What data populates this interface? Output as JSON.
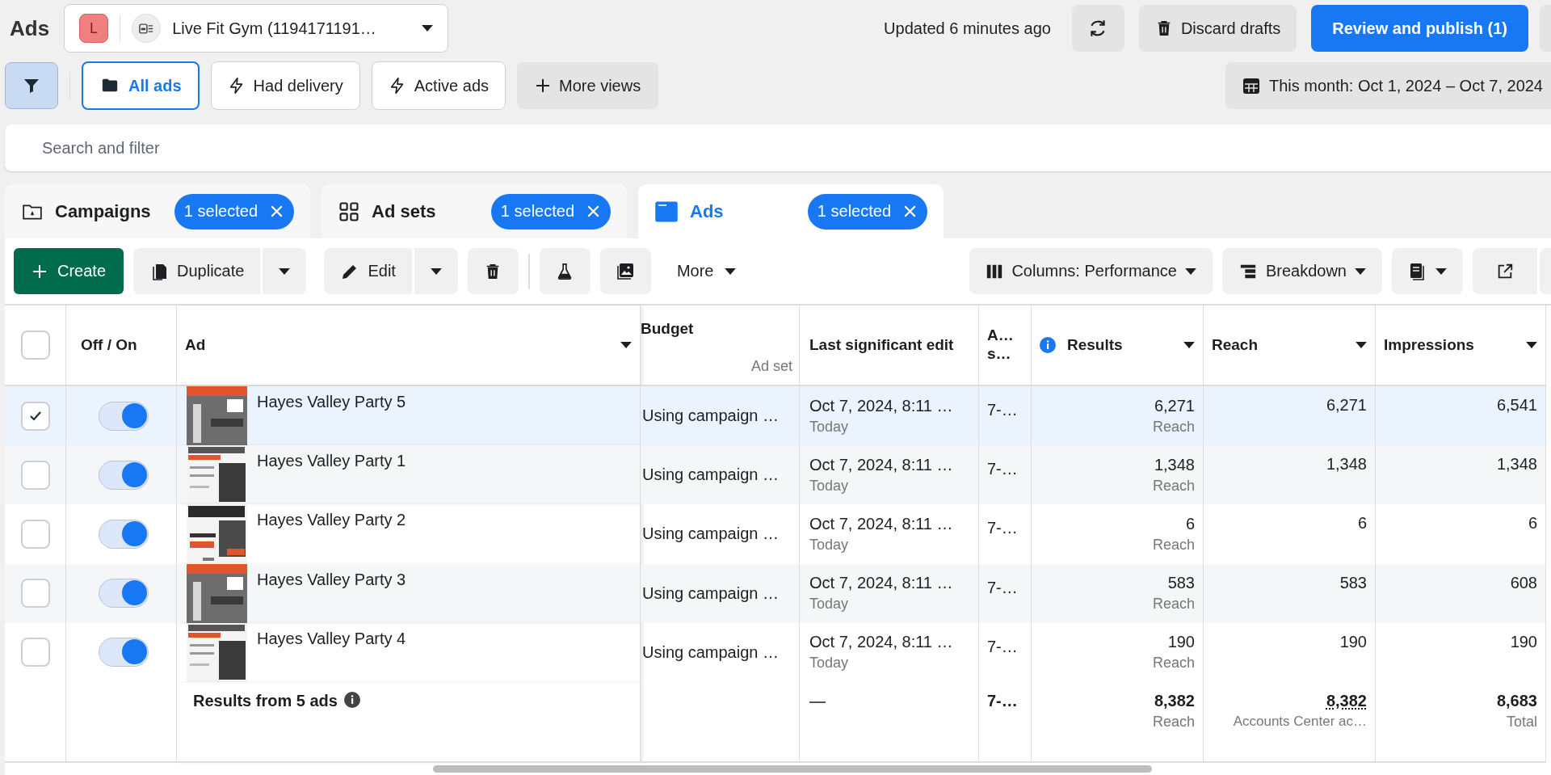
{
  "header": {
    "title": "Ads",
    "account": {
      "initial": "L",
      "name": "Live Fit Gym (1194171191…"
    },
    "updated": "Updated 6 minutes ago",
    "discard": "Discard drafts",
    "publish": "Review and publish (1)"
  },
  "views": [
    {
      "label": "All ads",
      "kind": "folder",
      "selected": true
    },
    {
      "label": "Had delivery",
      "kind": "bolt",
      "selected": false
    },
    {
      "label": "Active ads",
      "kind": "bolt",
      "selected": false
    }
  ],
  "more_views": "More views",
  "date_range": "This month: Oct 1, 2024 – Oct 7, 2024",
  "search": {
    "placeholder": "Search and filter"
  },
  "level_tabs": [
    {
      "label": "Campaigns",
      "kind": "campaign",
      "badge": "1 selected",
      "selected": false
    },
    {
      "label": "Ad sets",
      "kind": "adset",
      "badge": "1 selected",
      "selected": false
    },
    {
      "label": "Ads",
      "kind": "ad",
      "badge": "1 selected",
      "selected": true
    }
  ],
  "toolbar": {
    "create": "Create",
    "duplicate": "Duplicate",
    "edit": "Edit",
    "more": "More",
    "columns": "Columns: Performance",
    "breakdown": "Breakdown"
  },
  "table": {
    "select_all": {
      "checked": false
    },
    "columns": [
      {
        "label": "Off / On"
      },
      {
        "label": "Ad",
        "sortable": true
      },
      {
        "label": "Budget",
        "sub": "Ad set"
      },
      {
        "label": "Last significant edit"
      },
      {
        "label": "A… s…"
      },
      {
        "label": "Results",
        "info": true,
        "sortable": true
      },
      {
        "label": "Reach",
        "sortable": true
      },
      {
        "label": "Impressions",
        "sortable": true
      }
    ],
    "rows": [
      {
        "checked": true,
        "on": true,
        "ad": "Hayes Valley Party 5",
        "budget": "Using campaign …",
        "edit": "Oct 7, 2024, 8:11 …",
        "edit_sub": "Today",
        "column_5": "7-…",
        "results": "6,271",
        "results_sub": "Reach",
        "reach": "6,271",
        "impressions": "6,541"
      },
      {
        "checked": false,
        "on": true,
        "ad": "Hayes Valley Party 1",
        "budget": "Using campaign …",
        "edit": "Oct 7, 2024, 8:11 …",
        "edit_sub": "Today",
        "column_5": "7-…",
        "results": "1,348",
        "results_sub": "Reach",
        "reach": "1,348",
        "impressions": "1,348"
      },
      {
        "checked": false,
        "on": true,
        "ad": "Hayes Valley Party 2",
        "budget": "Using campaign …",
        "edit": "Oct 7, 2024, 8:11 …",
        "edit_sub": "Today",
        "column_5": "7-…",
        "results": "6",
        "results_sub": "Reach",
        "reach": "6",
        "impressions": "6"
      },
      {
        "checked": false,
        "on": true,
        "ad": "Hayes Valley Party 3",
        "budget": "Using campaign …",
        "edit": "Oct 7, 2024, 8:11 …",
        "edit_sub": "Today",
        "column_5": "7-…",
        "results": "583",
        "results_sub": "Reach",
        "reach": "583",
        "impressions": "608"
      },
      {
        "checked": false,
        "on": true,
        "ad": "Hayes Valley Party 4",
        "budget": "Using campaign …",
        "edit": "Oct 7, 2024, 8:11 …",
        "edit_sub": "Today",
        "column_5": "7-…",
        "results": "190",
        "results_sub": "Reach",
        "reach": "190",
        "impressions": "190"
      }
    ],
    "footer": {
      "label": "Results from 5 ads",
      "edit": "—",
      "column_5": "7-…",
      "results": "8,382",
      "results_sub": "Reach",
      "reach": "8,382",
      "reach_sub": "Accounts Center ac…",
      "impressions": "8,683",
      "impressions_sub": "Total"
    }
  }
}
